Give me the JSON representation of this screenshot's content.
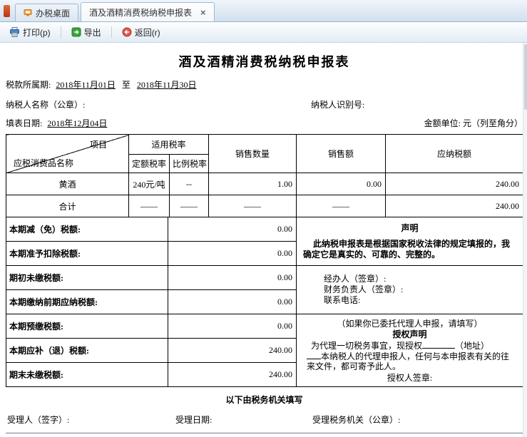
{
  "colors": {
    "print": "#4d88c4",
    "export": "#3aa63a",
    "back": "#e1564a",
    "tab_strip": "#c24a22"
  },
  "tabbar": {
    "tab_desktop": "办税桌面",
    "tab_form": "酒及酒精消费税纳税申报表",
    "close_label": "×"
  },
  "toolbar": {
    "print_label": "打印(p)",
    "export_label": "导出",
    "back_label": "返回(r)"
  },
  "form": {
    "title": "酒及酒精消费税纳税申报表",
    "period_label": "税款所属期:",
    "period_start": "2018年11月01日",
    "period_sep": "至",
    "period_end": "2018年11月30日",
    "taxpayer_name_label": "纳税人名称（公章）:",
    "taxpayer_id_label": "纳税人识别号:",
    "fill_date_label": "填表日期:",
    "fill_date_value": "2018年12月04日",
    "amount_unit": "金额单位: 元（列至角分）"
  },
  "main_table": {
    "header": {
      "diagonal_top": "项目",
      "diagonal_bottom": "应税消费品名称",
      "rate": "适用税率",
      "rate_fixed": "定额税率",
      "rate_ratio": "比例税率",
      "qty": "销售数量",
      "amount": "销售额",
      "tax": "应纳税额"
    },
    "rows": [
      {
        "name": "黄酒",
        "fixed": "240元/吨",
        "ratio": "--",
        "qty": "1.00",
        "amount": "0.00",
        "tax": "240.00"
      },
      {
        "name": "合计",
        "fixed": "——",
        "ratio": "——",
        "qty": "——",
        "amount": "——",
        "tax": "240.00"
      }
    ]
  },
  "detail_rows": [
    {
      "label": "本期减（免）税额:",
      "value": "0.00"
    },
    {
      "label": "本期准予扣除税额:",
      "value": "0.00"
    },
    {
      "label": "期初未缴税额:",
      "value": "0.00"
    },
    {
      "label": "本期缴纳前期应纳税额:",
      "value": "0.00"
    },
    {
      "label": "本期预缴税额:",
      "value": "0.00"
    },
    {
      "label": "本期应补（退）税额:",
      "value": "240.00"
    },
    {
      "label": "期末未缴税额:",
      "value": "240.00"
    }
  ],
  "declaration": {
    "title": "声明",
    "body": "此纳税申报表是根据国家税收法律的规定填报的，我确定它是真实的、可靠的、完整的。",
    "handler": "经办人（签章）:",
    "finance": "财务负责人（签章）:",
    "phone": "联系电话:",
    "agent_note": "（如果你已委托代理人申报，请填写）",
    "auth_title": "授权声明",
    "auth_line1": "为代理一切税务事宜，现授权",
    "auth_addr": "（地址）",
    "auth_line2": "本纳税人的代理申报人，任何与本申报表有关的往来文件，都可寄予此人。",
    "auth_sign": "授权人签章:"
  },
  "footer": {
    "tax_office_note": "以下由税务机关填写",
    "acceptor": "受理人（签字）:",
    "accept_date": "受理日期:",
    "accept_office": "受理税务机关（公章）:"
  }
}
